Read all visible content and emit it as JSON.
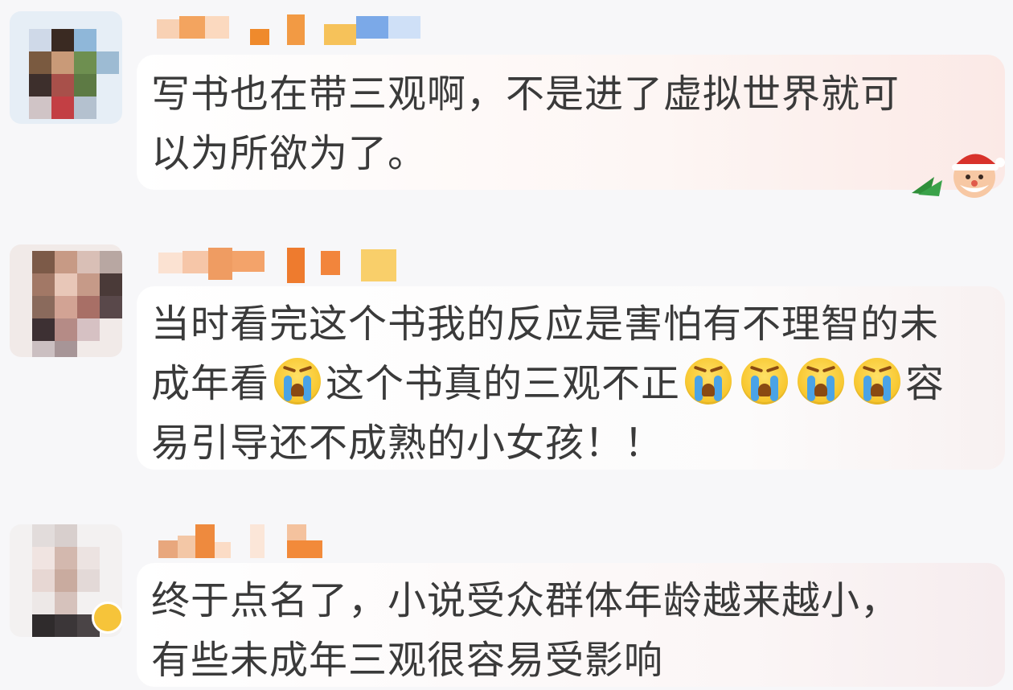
{
  "comments": [
    {
      "text": "写书也在带三观啊，不是进了虚拟世界就可以为所欲为了。",
      "line1": "写书也在带三观啊，不是进了虚拟世界就可",
      "line2": "以为所欲为了。",
      "avatar_icon": "avatar-pixelated",
      "username_icon": "username-pixelated"
    },
    {
      "text_lines": [
        "当时看完这个书我的反应是害怕有不理智的未",
        "成年看",
        "这个书真的三观不正",
        "容",
        "易引导还不成熟的小女孩！！"
      ],
      "emoji_icon": "crying-face-emoji",
      "avatar_icon": "avatar-pixelated",
      "username_icon": "username-pixelated"
    },
    {
      "line1": "终于点名了，小说受众群体年龄越来越小，",
      "line2": "有些未成年三观很容易受影响",
      "avatar_icon": "avatar-pixelated",
      "username_icon": "username-pixelated",
      "badge_icon": "verified-badge-icon"
    }
  ],
  "colors": {
    "bubble_start": "#ffffff",
    "bubble_end": "#fbe9e6",
    "emoji_yellow": "#f7c52b",
    "tear_blue": "#4aa3e6",
    "text": "#3a3a3a"
  }
}
